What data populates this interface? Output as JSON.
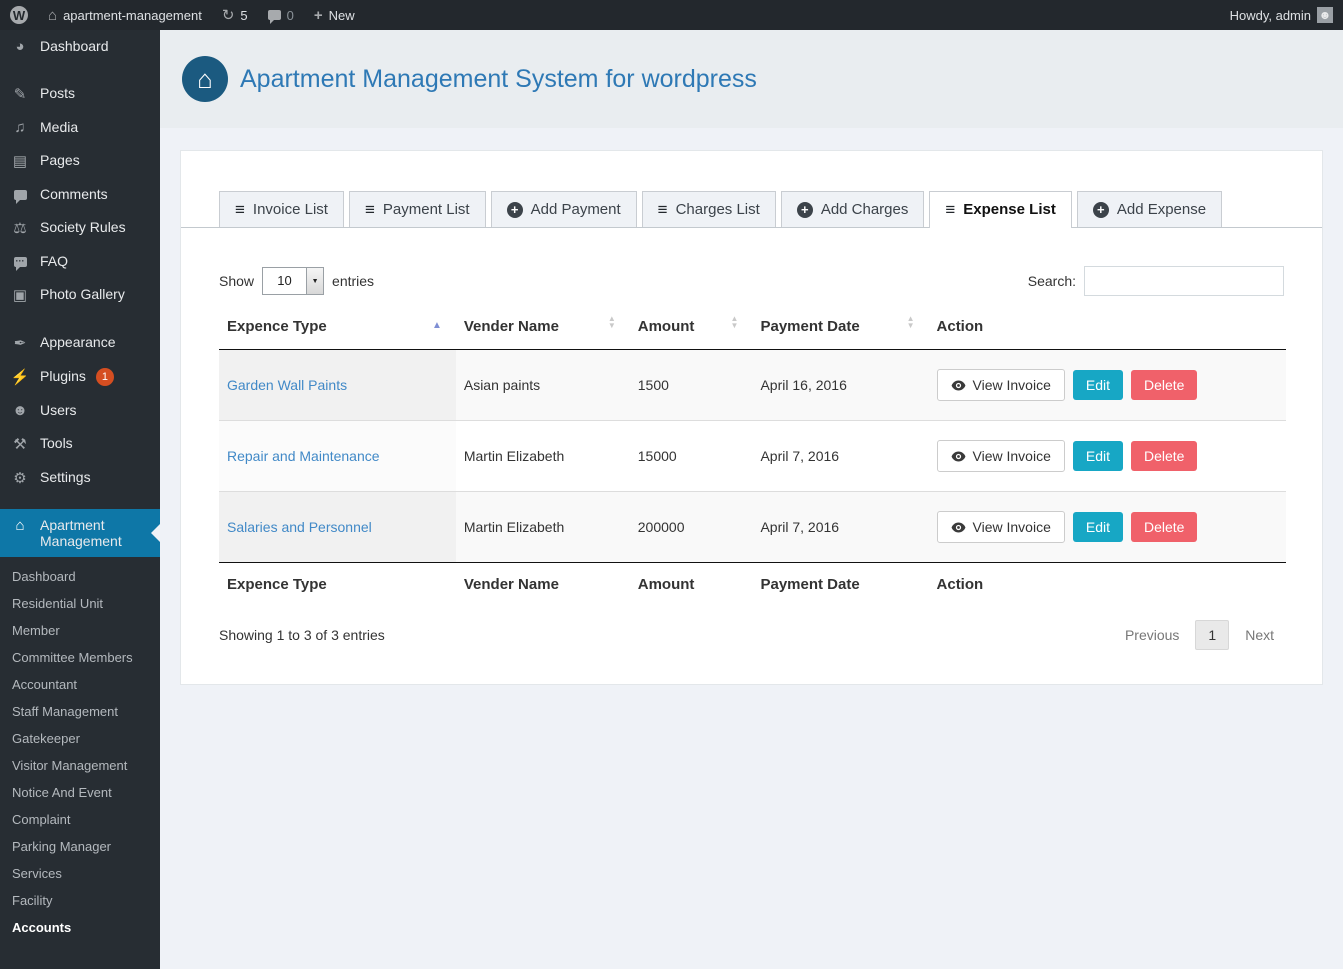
{
  "admin_bar": {
    "site_name": "apartment-management",
    "update_count": "5",
    "comment_count": "0",
    "new_label": "New",
    "howdy": "Howdy, admin"
  },
  "sidebar": {
    "items": [
      {
        "label": "Dashboard",
        "icon": "dashboard-icon"
      },
      {
        "label": "Posts",
        "icon": "posts-icon"
      },
      {
        "label": "Media",
        "icon": "media-icon"
      },
      {
        "label": "Pages",
        "icon": "pages-icon"
      },
      {
        "label": "Comments",
        "icon": "comments-icon"
      },
      {
        "label": "Society Rules",
        "icon": "society-rules-icon"
      },
      {
        "label": "FAQ",
        "icon": "faq-icon"
      },
      {
        "label": "Photo Gallery",
        "icon": "photo-gallery-icon"
      },
      {
        "label": "Appearance",
        "icon": "appearance-icon"
      },
      {
        "label": "Plugins",
        "icon": "plugins-icon",
        "badge": "1"
      },
      {
        "label": "Users",
        "icon": "users-icon"
      },
      {
        "label": "Tools",
        "icon": "tools-icon"
      },
      {
        "label": "Settings",
        "icon": "settings-icon"
      },
      {
        "label": "Apartment Management",
        "icon": "apartment-icon",
        "active": true
      }
    ],
    "submenu": [
      "Dashboard",
      "Residential Unit",
      "Member",
      "Committee Members",
      "Accountant",
      "Staff Management",
      "Gatekeeper",
      "Visitor Management",
      "Notice And Event",
      "Complaint",
      "Parking Manager",
      "Services",
      "Facility",
      "Accounts"
    ],
    "submenu_active": "Accounts"
  },
  "header": {
    "title": "Apartment Management System for wordpress"
  },
  "tabs": [
    {
      "label": "Invoice List",
      "icon": "list-icon"
    },
    {
      "label": "Payment List",
      "icon": "list-icon"
    },
    {
      "label": "Add Payment",
      "icon": "add-icon"
    },
    {
      "label": "Charges List",
      "icon": "list-icon"
    },
    {
      "label": "Add Charges",
      "icon": "add-icon"
    },
    {
      "label": "Expense List",
      "icon": "list-icon",
      "active": true
    },
    {
      "label": "Add Expense",
      "icon": "add-icon"
    }
  ],
  "datatable": {
    "show_label": "Show",
    "page_size": "10",
    "entries_label": "entries",
    "search_label": "Search:",
    "search_value": "",
    "columns": [
      "Expence Type",
      "Vender Name",
      "Amount",
      "Payment Date",
      "Action"
    ],
    "sorted_column": 0,
    "rows": [
      {
        "expence_type": "Garden Wall Paints",
        "vender_name": "Asian paints",
        "amount": "1500",
        "payment_date": "April 16, 2016"
      },
      {
        "expence_type": "Repair and Maintenance",
        "vender_name": "Martin Elizabeth",
        "amount": "15000",
        "payment_date": "April 7, 2016"
      },
      {
        "expence_type": "Salaries and Personnel",
        "vender_name": "Martin Elizabeth",
        "amount": "200000",
        "payment_date": "April 7, 2016"
      }
    ],
    "actions": {
      "view": "View Invoice",
      "edit": "Edit",
      "delete": "Delete"
    },
    "info": "Showing 1 to 3 of 3 entries",
    "pagination": {
      "previous": "Previous",
      "current": "1",
      "next": "Next"
    }
  },
  "colors": {
    "accent": "#0e77a7",
    "edit_button": "#17a7c5",
    "delete_button": "#f0616a",
    "link": "#4189c7",
    "title": "#2e79b5",
    "badge": "#d54e21"
  }
}
